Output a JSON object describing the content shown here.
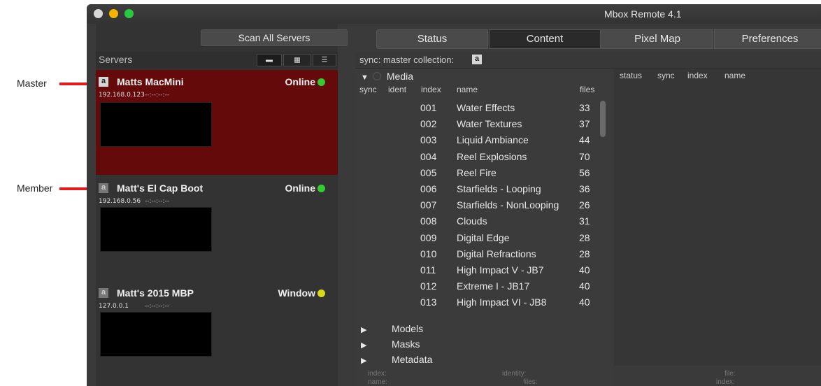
{
  "callouts": {
    "master": "Master",
    "member": "Member"
  },
  "window": {
    "title": "Mbox Remote 4.1"
  },
  "left": {
    "scan_button": "Scan All Servers",
    "servers_label": "Servers",
    "servers": [
      {
        "badge": "a",
        "name": "Matts MacMini",
        "status": "Online",
        "ip": "192.168.0.123",
        "time": "--:--:--:--"
      },
      {
        "badge": "a",
        "name": "Matt's El Cap Boot",
        "status": "Online",
        "ip": "192.168.0.56",
        "time": "--:--:--:--"
      },
      {
        "badge": "a",
        "name": "Matt's 2015 MBP",
        "status": "Window",
        "ip": "127.0.0.1",
        "time": "--:--:--:--"
      }
    ]
  },
  "tabs": [
    "Status",
    "Content",
    "Pixel Map",
    "Preferences"
  ],
  "sync_bar": {
    "label": "sync: master collection:",
    "badge": "a"
  },
  "media": {
    "title": "Media",
    "columns": {
      "sync": "sync",
      "ident": "ident",
      "index": "index",
      "name": "name",
      "files": "files"
    },
    "rows": [
      {
        "index": "001",
        "name": "Water Effects",
        "files": "33"
      },
      {
        "index": "002",
        "name": "Water Textures",
        "files": "37"
      },
      {
        "index": "003",
        "name": "Liquid Ambiance",
        "files": "44"
      },
      {
        "index": "004",
        "name": "Reel Explosions",
        "files": "70"
      },
      {
        "index": "005",
        "name": "Reel Fire",
        "files": "56"
      },
      {
        "index": "006",
        "name": "Starfields - Looping",
        "files": "36"
      },
      {
        "index": "007",
        "name": "Starfields - NonLooping",
        "files": "26"
      },
      {
        "index": "008",
        "name": "Clouds",
        "files": "31"
      },
      {
        "index": "009",
        "name": "Digital Edge",
        "files": "28"
      },
      {
        "index": "010",
        "name": "Digital Refractions",
        "files": "28"
      },
      {
        "index": "011",
        "name": "High Impact V - JB7",
        "files": "40"
      },
      {
        "index": "012",
        "name": "Extreme I - JB17",
        "files": "40"
      },
      {
        "index": "013",
        "name": "High Impact VI - JB8",
        "files": "40"
      }
    ]
  },
  "tree": [
    "Models",
    "Masks",
    "Metadata"
  ],
  "right_columns": {
    "status": "status",
    "sync": "sync",
    "index": "index",
    "name": "name"
  },
  "bottom": {
    "index": "index:",
    "identity": "identity:",
    "name": "name:",
    "files": "files:",
    "file": "file:",
    "index2": "index:"
  }
}
